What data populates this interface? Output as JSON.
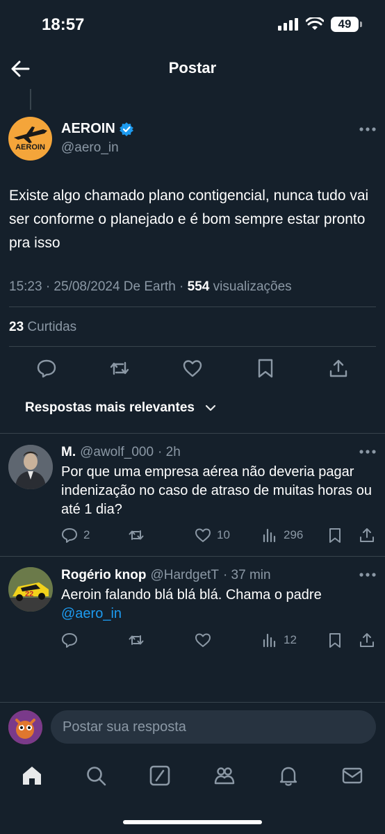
{
  "status_bar": {
    "time": "18:57",
    "battery": "49"
  },
  "header": {
    "title": "Postar"
  },
  "tweet": {
    "author_name": "AEROIN",
    "author_handle": "@aero_in",
    "avatar_text": "AEROIN",
    "text": "Existe algo chamado plano contigencial, nunca tudo vai ser conforme o planejado e é bom sempre estar pronto pra isso",
    "meta_prefix": "15:23 · 25/08/2024 De Earth · ",
    "views_count": "554",
    "views_label": " visualizações",
    "likes_count": "23",
    "likes_label": " Curtidas"
  },
  "sort_label": "Respostas mais relevantes",
  "replies": [
    {
      "name": "M.",
      "handle": "@awolf_000",
      "time": "· 2h",
      "text": "Por que uma empresa aérea não deveria pagar indenização no caso de atraso de muitas horas ou até 1 dia?",
      "reply_count": "2",
      "like_count": "10",
      "view_count": "296"
    },
    {
      "name": "Rogério knop",
      "handle": "@HardgetT",
      "time": "· 37 min",
      "text": "Aeroin falando blá blá blá. Chama o padre",
      "mention": "@aero_in",
      "view_count": "12"
    }
  ],
  "compose": {
    "placeholder": "Postar sua resposta"
  },
  "colors": {
    "background": "#15202b",
    "accent": "#1d9bf0",
    "muted": "#8b98a5",
    "divider": "#38444d"
  }
}
